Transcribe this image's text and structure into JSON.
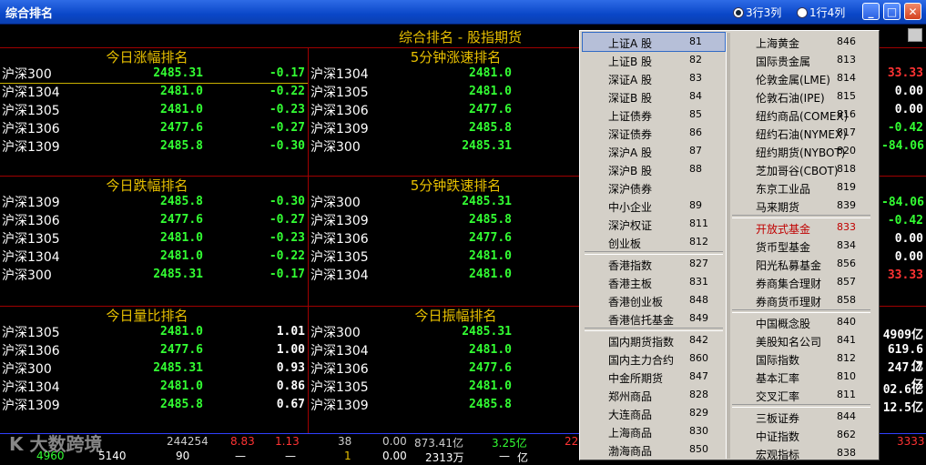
{
  "window": {
    "title": "综合排名",
    "layout_options": [
      {
        "label": "3行3列",
        "selected": true
      },
      {
        "label": "1行4列",
        "selected": false
      }
    ],
    "buttons": {
      "minimize": "_",
      "maximize": "□",
      "close": "✕"
    }
  },
  "subtitle": "综合排名 - 股指期货",
  "panels": [
    {
      "title": "今日涨幅排名",
      "rows": [
        {
          "name": "沪深300",
          "price": "2485.31",
          "change": "-0.17",
          "color": "green"
        },
        {
          "name": "沪深1304",
          "price": "2481.0",
          "change": "-0.22",
          "color": "green"
        },
        {
          "name": "沪深1305",
          "price": "2481.0",
          "change": "-0.23",
          "color": "green"
        },
        {
          "name": "沪深1306",
          "price": "2477.6",
          "change": "-0.27",
          "color": "green"
        },
        {
          "name": "沪深1309",
          "price": "2485.8",
          "change": "-0.30",
          "color": "green"
        }
      ]
    },
    {
      "title": "5分钟涨速排名",
      "rows": [
        {
          "name": "沪深1304",
          "price": "2481.0",
          "change": "",
          "color": "green"
        },
        {
          "name": "沪深1305",
          "price": "2481.0",
          "change": "",
          "color": "green"
        },
        {
          "name": "沪深1306",
          "price": "2477.6",
          "change": "",
          "color": "green"
        },
        {
          "name": "沪深1309",
          "price": "2485.8",
          "change": "",
          "color": "green"
        },
        {
          "name": "沪深300",
          "price": "2485.31",
          "change": "",
          "color": "green"
        }
      ]
    },
    {
      "title": "今日跌幅排名",
      "rows": [
        {
          "name": "沪深1309",
          "price": "2485.8",
          "change": "-0.30",
          "color": "green"
        },
        {
          "name": "沪深1306",
          "price": "2477.6",
          "change": "-0.27",
          "color": "green"
        },
        {
          "name": "沪深1305",
          "price": "2481.0",
          "change": "-0.23",
          "color": "green"
        },
        {
          "name": "沪深1304",
          "price": "2481.0",
          "change": "-0.22",
          "color": "green"
        },
        {
          "name": "沪深300",
          "price": "2485.31",
          "change": "-0.17",
          "color": "green"
        }
      ]
    },
    {
      "title": "5分钟跌速排名",
      "rows": [
        {
          "name": "沪深300",
          "price": "2485.31",
          "change": "",
          "color": "green"
        },
        {
          "name": "沪深1309",
          "price": "2485.8",
          "change": "",
          "color": "green"
        },
        {
          "name": "沪深1306",
          "price": "2477.6",
          "change": "",
          "color": "green"
        },
        {
          "name": "沪深1305",
          "price": "2481.0",
          "change": "",
          "color": "green"
        },
        {
          "name": "沪深1304",
          "price": "2481.0",
          "change": "",
          "color": "green"
        }
      ]
    },
    {
      "title": "今日量比排名",
      "rows": [
        {
          "name": "沪深1305",
          "price": "2481.0",
          "change": "1.01",
          "color": "white"
        },
        {
          "name": "沪深1306",
          "price": "2477.6",
          "change": "1.00",
          "color": "white"
        },
        {
          "name": "沪深300",
          "price": "2485.31",
          "change": "0.93",
          "color": "white"
        },
        {
          "name": "沪深1304",
          "price": "2481.0",
          "change": "0.86",
          "color": "white"
        },
        {
          "name": "沪深1309",
          "price": "2485.8",
          "change": "0.67",
          "color": "white"
        }
      ]
    },
    {
      "title": "今日振幅排名",
      "rows": [
        {
          "name": "沪深300",
          "price": "2485.31",
          "change": "",
          "color": "green"
        },
        {
          "name": "沪深1304",
          "price": "2481.0",
          "change": "",
          "color": "green"
        },
        {
          "name": "沪深1306",
          "price": "2477.6",
          "change": "",
          "color": "green"
        },
        {
          "name": "沪深1305",
          "price": "2481.0",
          "change": "",
          "color": "green"
        },
        {
          "name": "沪深1309",
          "price": "2485.8",
          "change": "",
          "color": "green"
        }
      ]
    }
  ],
  "right_column": {
    "block1": [
      {
        "text": "33.33",
        "color": "red"
      },
      {
        "text": "0.00",
        "color": "white"
      },
      {
        "text": "0.00",
        "color": "white"
      },
      {
        "text": "-0.42",
        "color": "green"
      },
      {
        "text": "-84.06",
        "color": "green"
      }
    ],
    "block2": [
      {
        "text": "-84.06",
        "color": "green"
      },
      {
        "text": "-0.42",
        "color": "green"
      },
      {
        "text": "0.00",
        "color": "white"
      },
      {
        "text": "0.00",
        "color": "white"
      },
      {
        "text": "33.33",
        "color": "red"
      }
    ],
    "block3": [
      {
        "text": "4909亿",
        "color": "white"
      },
      {
        "text": "619.6亿",
        "color": "white"
      },
      {
        "text": "247.7亿",
        "color": "white"
      },
      {
        "text": "02.6亿",
        "color": "white"
      },
      {
        "text": "12.5亿",
        "color": "white"
      }
    ]
  },
  "bottom_strip": {
    "row1": [
      "244254",
      "8.83",
      "1.13",
      "38",
      "0.00",
      "873.41亿",
      "3.25亿",
      "22",
      "3333"
    ],
    "row2": [
      "4960",
      "5140",
      "90",
      "—",
      "—",
      "1",
      "0.00",
      "2313万",
      "—",
      "亿"
    ]
  },
  "watermark": "K 大数跨境",
  "menu": {
    "left": [
      [
        {
          "label": "上证A 股",
          "code": "81",
          "selected": true
        },
        {
          "label": "上证B 股",
          "code": "82"
        },
        {
          "label": "深证A 股",
          "code": "83"
        },
        {
          "label": "深证B 股",
          "code": "84"
        },
        {
          "label": "上证债券",
          "code": "85"
        },
        {
          "label": "深证债券",
          "code": "86"
        },
        {
          "label": "深沪A 股",
          "code": "87"
        },
        {
          "label": "深沪B 股",
          "code": "88"
        },
        {
          "label": "深沪债券",
          "code": ""
        },
        {
          "label": "中小企业",
          "code": "89"
        },
        {
          "label": "深沪权证",
          "code": "811"
        },
        {
          "label": "创业板",
          "code": "812"
        }
      ],
      [
        {
          "label": "香港指数",
          "code": "827"
        },
        {
          "label": "香港主板",
          "code": "831"
        },
        {
          "label": "香港创业板",
          "code": "848"
        },
        {
          "label": "香港信托基金",
          "code": "849"
        }
      ],
      [
        {
          "label": "国内期货指数",
          "code": "842"
        },
        {
          "label": "国内主力合约",
          "code": "860"
        },
        {
          "label": "中金所期货",
          "code": "847"
        },
        {
          "label": "郑州商品",
          "code": "828"
        },
        {
          "label": "大连商品",
          "code": "829"
        },
        {
          "label": "上海商品",
          "code": "830"
        },
        {
          "label": "渤海商品",
          "code": "850"
        }
      ]
    ],
    "right": [
      [
        {
          "label": "上海黄金",
          "code": "846"
        },
        {
          "label": "国际贵金属",
          "code": "813"
        },
        {
          "label": "伦敦金属(LME)",
          "code": "814"
        },
        {
          "label": "伦敦石油(IPE)",
          "code": "815"
        },
        {
          "label": "纽约商品(COMEX)",
          "code": "816"
        },
        {
          "label": "纽约石油(NYMEX)",
          "code": "817"
        },
        {
          "label": "纽约期货(NYBOT)",
          "code": "820"
        },
        {
          "label": "芝加哥谷(CBOT)",
          "code": "818"
        },
        {
          "label": "东京工业品",
          "code": "819"
        },
        {
          "label": "马来期货",
          "code": "839"
        }
      ],
      [
        {
          "label": "开放式基金",
          "code": "833",
          "highlight": true
        },
        {
          "label": "货币型基金",
          "code": "834"
        },
        {
          "label": "阳光私募基金",
          "code": "856"
        },
        {
          "label": "券商集合理财",
          "code": "857"
        },
        {
          "label": "券商货币理财",
          "code": "858"
        }
      ],
      [
        {
          "label": "中国概念股",
          "code": "840"
        },
        {
          "label": "美股知名公司",
          "code": "841"
        },
        {
          "label": "国际指数",
          "code": "812"
        },
        {
          "label": "基本汇率",
          "code": "810"
        },
        {
          "label": "交叉汇率",
          "code": "811"
        }
      ],
      [
        {
          "label": "三板证券",
          "code": "844"
        },
        {
          "label": "中证指数",
          "code": "862"
        },
        {
          "label": "宏观指标",
          "code": "838"
        }
      ]
    ]
  }
}
